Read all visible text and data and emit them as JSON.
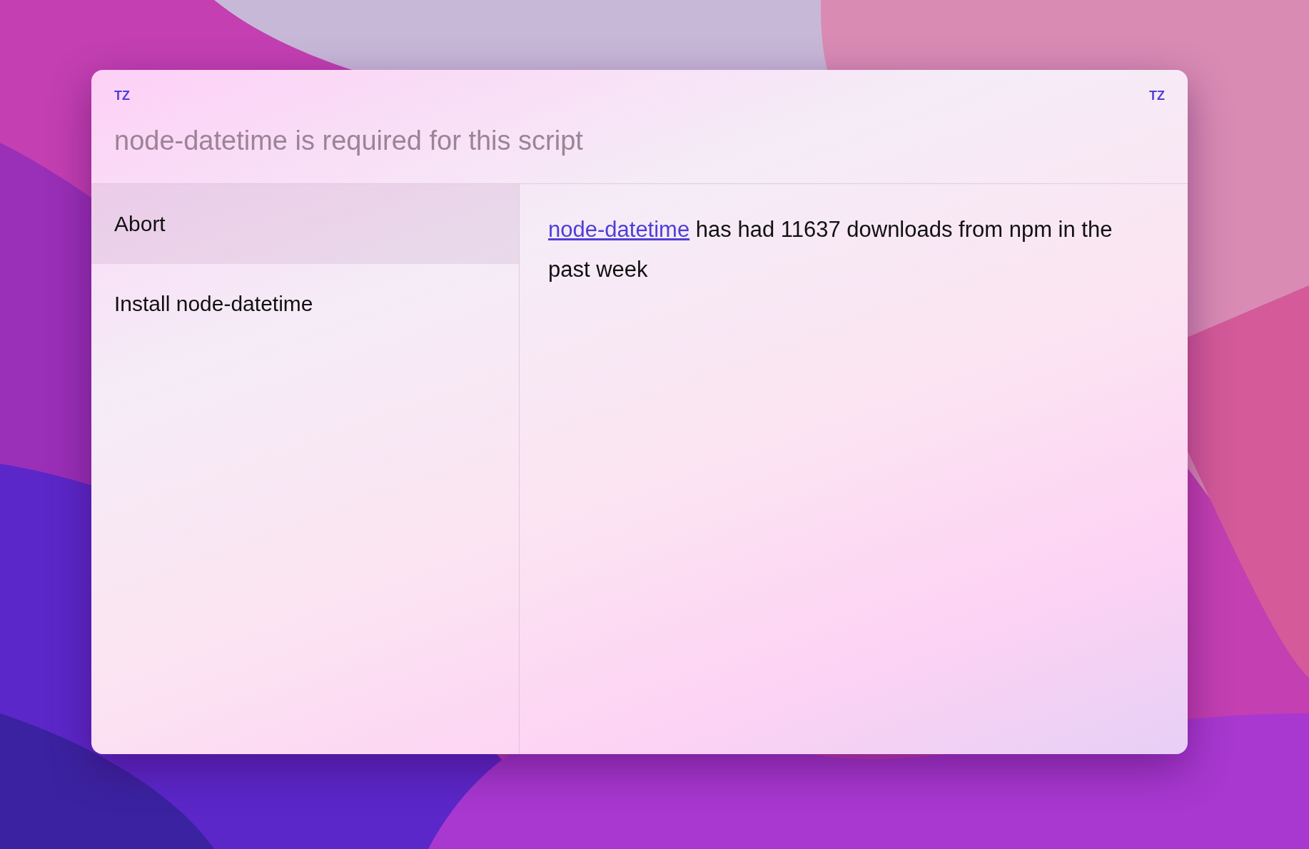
{
  "header": {
    "left_label": "TZ",
    "right_label": "TZ"
  },
  "input": {
    "placeholder": "node-datetime is required for this script"
  },
  "choices": [
    {
      "label": "Abort",
      "selected": true
    },
    {
      "label": "Install node-datetime",
      "selected": false
    }
  ],
  "preview": {
    "link": "node-datetime",
    "text": "has had 11637 downloads from npm in the past week"
  }
}
